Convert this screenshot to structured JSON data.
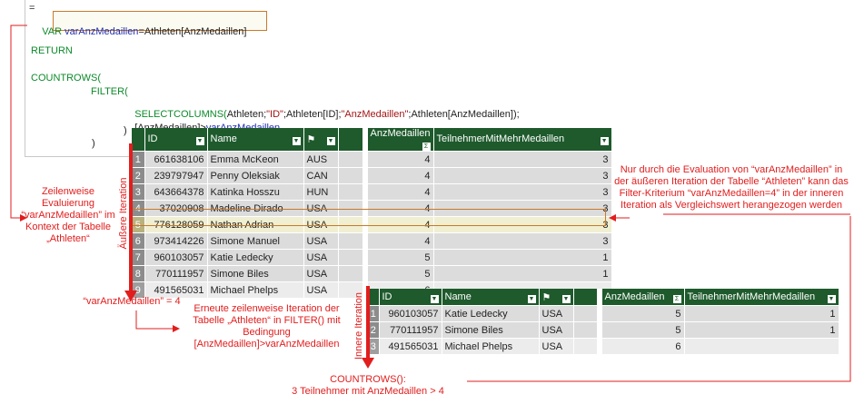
{
  "code": {
    "line_eq": "=",
    "var_kw": "VAR",
    "var_name": "varAnzMedaillen",
    "var_expr": "=Athleten[AnzMedaillen]",
    "return_kw": "RETURN",
    "countrows": "COUNTROWS(",
    "filter": "FILTER(",
    "selectcolumns_fn": "SELECTCOLUMNS(",
    "sc_args1": "Athleten;",
    "sc_id_str": "\"ID\"",
    "sc_args2": ";Athleten[ID];",
    "sc_anz_str": "\"AnzMedaillen\"",
    "sc_args3": ";Athleten[AnzMedaillen]);",
    "cond_prefix": "[AnzMedaillen]>",
    "cond_var": "varAnzMedaillen",
    "close1": ")",
    "close2": ")"
  },
  "outer_table": {
    "headers": [
      "ID",
      "Name",
      "",
      "",
      "AnzMedaillen",
      "TeilnehmerMitMehrMedaillen"
    ],
    "rows": [
      {
        "idx": "1",
        "id": "661638106",
        "name": "Emma McKeon",
        "country": "AUS",
        "medals": "4",
        "count": "3"
      },
      {
        "idx": "2",
        "id": "239797947",
        "name": "Penny Oleksiak",
        "country": "CAN",
        "medals": "4",
        "count": "3"
      },
      {
        "idx": "3",
        "id": "643664378",
        "name": "Katinka Hosszu",
        "country": "HUN",
        "medals": "4",
        "count": "3"
      },
      {
        "idx": "4",
        "id": "37020908",
        "name": "Madeline Dirado",
        "country": "USA",
        "medals": "4",
        "count": "3"
      },
      {
        "idx": "5",
        "id": "776128059",
        "name": "Nathan Adrian",
        "country": "USA",
        "medals": "4",
        "count": "3"
      },
      {
        "idx": "6",
        "id": "973414226",
        "name": "Simone Manuel",
        "country": "USA",
        "medals": "4",
        "count": "3"
      },
      {
        "idx": "7",
        "id": "960103057",
        "name": "Katie Ledecky",
        "country": "USA",
        "medals": "5",
        "count": "1"
      },
      {
        "idx": "8",
        "id": "770111957",
        "name": "Simone Biles",
        "country": "USA",
        "medals": "5",
        "count": "1"
      },
      {
        "idx": "9",
        "id": "491565031",
        "name": "Michael Phelps",
        "country": "USA",
        "medals": "6",
        "count": ""
      }
    ]
  },
  "inner_table": {
    "headers": [
      "ID",
      "Name",
      "",
      "",
      "AnzMedaillen",
      "TeilnehmerMitMehrMedaillen"
    ],
    "rows": [
      {
        "idx": "1",
        "id": "960103057",
        "name": "Katie Ledecky",
        "country": "USA",
        "medals": "5",
        "count": "1"
      },
      {
        "idx": "2",
        "id": "770111957",
        "name": "Simone Biles",
        "country": "USA",
        "medals": "5",
        "count": "1"
      },
      {
        "idx": "3",
        "id": "491565031",
        "name": "Michael Phelps",
        "country": "USA",
        "medals": "6",
        "count": ""
      }
    ]
  },
  "annotations": {
    "left_title": "Zeilenweise Evaluierung “varAnzMedaillen” im Kontext der Tabelle „Athleten“",
    "outer_iter": "Äußere Iteration",
    "inner_iter": "Innere Iteration",
    "var_eq": "“varAnzMedaillen” = 4",
    "mid_text": "Erneute zeilenweise Iteration der Tabelle „Athleten“ in FILTER() mit Bedingung [AnzMedaillen]>varAnzMedaillen",
    "right_text": "Nur durch die Evaluation von “varAnzMedaillen” in der äußeren Iteration der Tabelle “Athleten” kann das Filter-Kriterium “varAnzMedaillen=4” in der inneren Iteration als Vergleichswert herangezogen werden",
    "bottom_title": "COUNTROWS():",
    "bottom_sub": "3 Teilnehmer mit AnzMedaillen > 4"
  },
  "colors": {
    "header_green": "#1e5a2c",
    "annotation_red": "#e21d1d",
    "highlight_orange": "#c87a2a"
  }
}
